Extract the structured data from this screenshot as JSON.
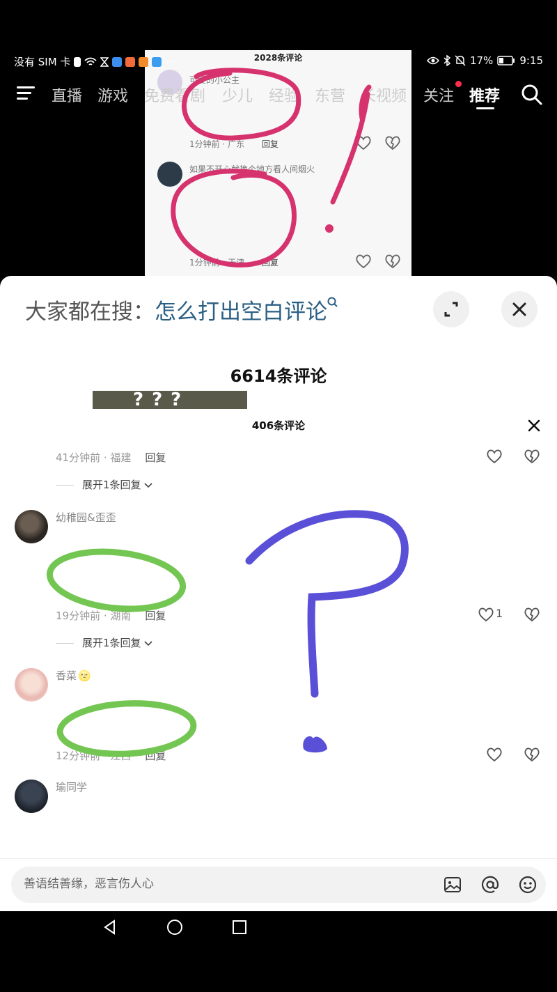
{
  "status_bar": {
    "carrier": "没有 SIM 卡",
    "icons_left": [
      "sim-alert-icon",
      "wifi-icon",
      "hourglass-icon",
      "app-notify-icon",
      "app-notify-icon",
      "app-notify-icon",
      "app-notify-icon"
    ],
    "overflow": "···",
    "icons_right": [
      "eye-comfort-icon",
      "bluetooth-icon",
      "mute-icon"
    ],
    "battery": "17%",
    "time": "9:15"
  },
  "top_nav": {
    "tabs": [
      "直播",
      "游戏",
      "免费看剧",
      "少儿",
      "经验",
      "东营",
      "长视频",
      "关注",
      "推荐"
    ],
    "active": "推荐",
    "has_notification_on": "关注"
  },
  "video_frame": {
    "title": "2028条评论",
    "comment1_user": "可爱的小公主",
    "comment1_meta": "1分钟前 · 广东",
    "comment1_reply": "回复",
    "comment2_text": "如果不开心就换个地方看人间烟火",
    "comment2_meta": "1分钟前 · 天津",
    "comment2_reply": "回复"
  },
  "sheet": {
    "search_prefix": "大家都在搜：",
    "search_term": "怎么打出空白评论",
    "comment_count": "6614条评论",
    "inset_marks": "???",
    "inner_title": "406条评论",
    "comments": [
      {
        "meta_time": "41分钟前",
        "meta_region": "福建",
        "reply": "回复",
        "expand": "展开1条回复"
      },
      {
        "user": "幼稚园&歪歪",
        "meta_time": "19分钟前",
        "meta_region": "湖南",
        "reply": "回复",
        "likes": "1",
        "expand": "展开1条回复"
      },
      {
        "user": "香菜",
        "user_emoji": "🌝",
        "meta_time": "12分钟前",
        "meta_region": "江西",
        "reply": "回复"
      },
      {
        "user": "瑜同学"
      }
    ],
    "input_placeholder": "善语结善缘，恶言伤人心",
    "input_icons": [
      "image-icon",
      "at-icon",
      "emoji-icon"
    ]
  },
  "system_nav": [
    "back-icon",
    "home-icon",
    "recents-icon"
  ],
  "colors": {
    "pink_scribble": "#d6326e",
    "blue_scribble": "#5a50d8",
    "green_scribble": "#74c653",
    "search_term": "#2b5f83",
    "notify_dot": "#ff2d4d"
  }
}
